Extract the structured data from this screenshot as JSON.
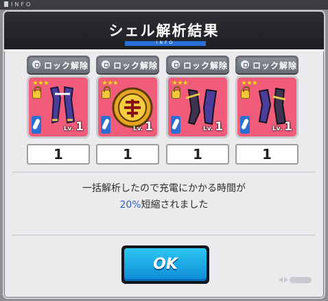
{
  "topbar": {
    "label": "INFO"
  },
  "dialog": {
    "title": "シェル解析結果",
    "subtitle": "INFO",
    "message_line1": "一括解析したので充電にかかる時間が",
    "percent": "20%",
    "message_line2_rest": "短縮されました",
    "ok_label": "OK"
  },
  "items": [
    {
      "unlock_label": "ロック解除",
      "level_prefix": "Lv.",
      "level": "1",
      "count": "1",
      "stars": "★★★",
      "art": "armor-icon"
    },
    {
      "unlock_label": "ロック解除",
      "level_prefix": "Lv.",
      "level": "1",
      "count": "1",
      "stars": "★★★",
      "art": "emblem-icon"
    },
    {
      "unlock_label": "ロック解除",
      "level_prefix": "Lv.",
      "level": "1",
      "count": "1",
      "stars": "★★★",
      "art": "boots-icon"
    },
    {
      "unlock_label": "ロック解除",
      "level_prefix": "Lv.",
      "level": "1",
      "count": "1",
      "stars": "★★★",
      "art": "gauntlet-icon"
    }
  ],
  "colors": {
    "accent": "#2a6fd6",
    "card": "#f05c7a",
    "ok_button": "#1aa9e6",
    "percent": "#2a64c8"
  }
}
